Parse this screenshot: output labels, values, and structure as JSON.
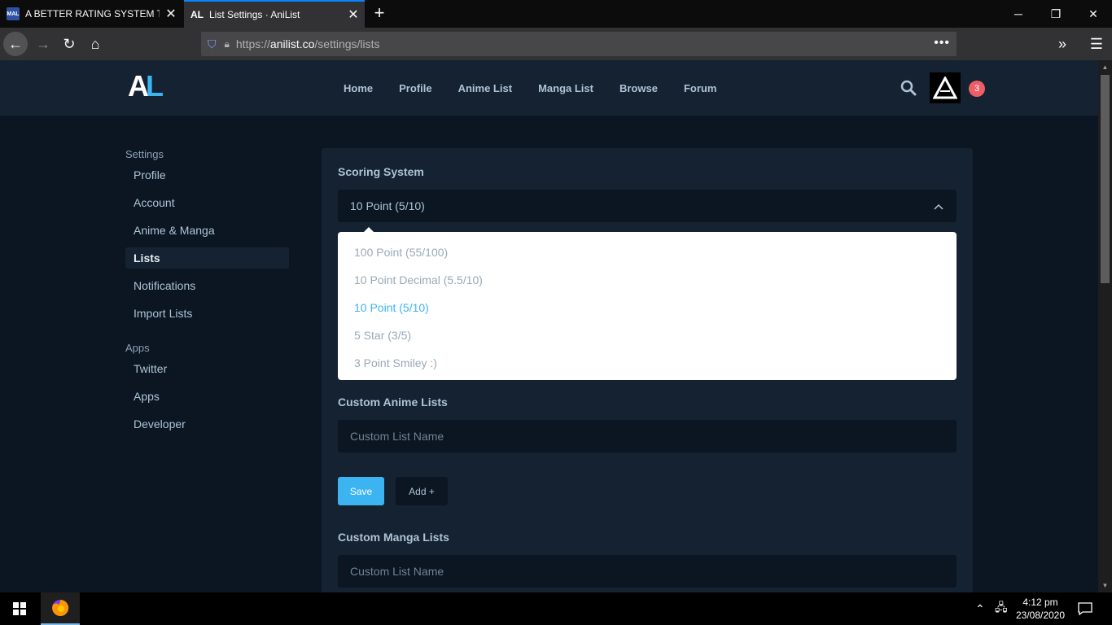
{
  "browser": {
    "tabs": [
      {
        "favicon": "MAL",
        "title": "A BETTER RATING SYSTEM THAN"
      },
      {
        "favicon": "AL",
        "title": "List Settings · AniList"
      }
    ],
    "url_prefix": "https://",
    "url_host": "anilist.co",
    "url_path": "/settings/lists"
  },
  "site": {
    "logo_a": "A",
    "logo_l": "L",
    "nav": [
      "Home",
      "Profile",
      "Anime List",
      "Manga List",
      "Browse",
      "Forum"
    ],
    "notification_count": "3"
  },
  "sidebar": {
    "settings_heading": "Settings",
    "settings_items": [
      {
        "label": "Profile"
      },
      {
        "label": "Account"
      },
      {
        "label": "Anime & Manga"
      },
      {
        "label": "Lists",
        "active": true
      },
      {
        "label": "Notifications"
      },
      {
        "label": "Import Lists"
      }
    ],
    "apps_heading": "Apps",
    "apps_items": [
      {
        "label": "Twitter"
      },
      {
        "label": "Apps"
      },
      {
        "label": "Developer"
      }
    ]
  },
  "scoring": {
    "label": "Scoring System",
    "selected": "10 Point (5/10)",
    "options": [
      "100 Point (55/100)",
      "10 Point Decimal (5.5/10)",
      "10 Point (5/10)",
      "5 Star (3/5)",
      "3 Point Smiley :)"
    ]
  },
  "custom_anime": {
    "label": "Custom Anime Lists",
    "placeholder": "Custom List Name",
    "save_label": "Save",
    "add_label": "Add +"
  },
  "custom_manga": {
    "label": "Custom Manga Lists",
    "placeholder": "Custom List Name"
  },
  "taskbar": {
    "time": "4:12 pm",
    "date": "23/08/2020"
  },
  "colors": {
    "accent": "#3db4f2",
    "page_bg": "#0b1622",
    "card_bg": "#152232",
    "notification": "#ec5f67"
  }
}
